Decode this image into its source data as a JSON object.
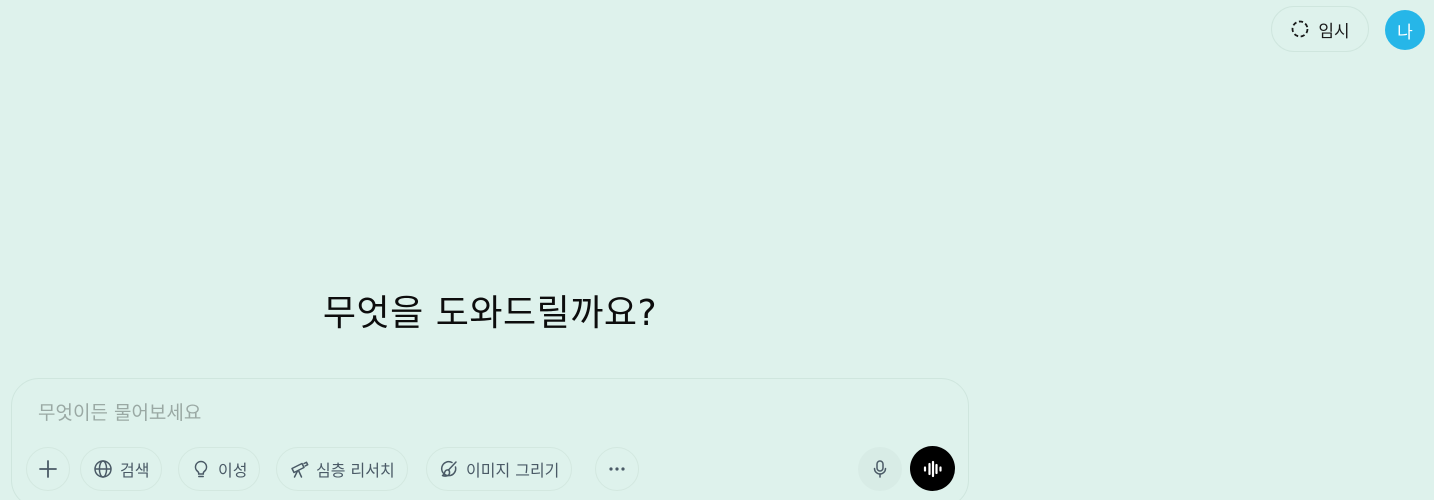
{
  "header": {
    "temporary_label": "임시",
    "avatar_initial": "나"
  },
  "main": {
    "headline": "무엇을 도와드릴까요?"
  },
  "composer": {
    "placeholder": "무엇이든 물어보세요",
    "tools": [
      {
        "label": "검색",
        "icon": "globe-icon"
      },
      {
        "label": "이성",
        "icon": "lightbulb-icon"
      },
      {
        "label": "심층 리서치",
        "icon": "telescope-icon"
      },
      {
        "label": "이미지 그리기",
        "icon": "paintbrush-icon"
      }
    ]
  },
  "colors": {
    "background": "#def2ec",
    "avatar": "#26b6e8",
    "voice_button": "#000000"
  }
}
